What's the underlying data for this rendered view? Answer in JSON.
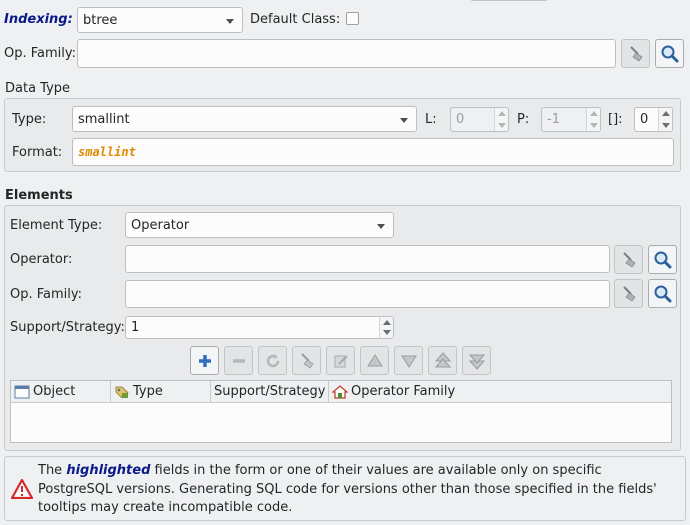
{
  "general": {
    "indexing_label": "Indexing:",
    "indexing_value": "btree",
    "default_class_label": "Default Class:",
    "default_class_checked": false,
    "op_family_label": "Op. Family:",
    "op_family_value": ""
  },
  "data_type": {
    "section_title": "Data Type",
    "type_label": "Type:",
    "type_value": "smallint",
    "length_label": "L:",
    "length_value": "0",
    "precision_label": "P:",
    "precision_value": "-1",
    "dimension_label": "[]:",
    "dimension_value": "0",
    "format_label": "Format:",
    "format_value": "smallint",
    "format_color": "#e08a00"
  },
  "elements": {
    "section_title": "Elements",
    "element_type_label": "Element Type:",
    "element_type_value": "Operator",
    "operator_label": "Operator:",
    "operator_value": "",
    "op_family_label": "Op. Family:",
    "op_family_value": "",
    "support_label": "Support/Strategy:",
    "support_value": "1",
    "toolbar_icons": [
      "add-icon",
      "remove-icon",
      "update-icon",
      "clear-icon",
      "edit-icon",
      "move-up-icon",
      "move-down-icon",
      "move-top-icon",
      "move-bottom-icon"
    ],
    "columns": [
      "Object",
      "Type",
      "Support/Strategy",
      "Operator Family"
    ],
    "rows": []
  },
  "alert": {
    "text_before": "The ",
    "highlight": "highlighted",
    "text_after": " fields in the form or one of their values are available only on specific PostgreSQL versions. Generating SQL code for versions other than those specified in the fields' tooltips may create incompatible code.",
    "icon": "warning-icon"
  }
}
